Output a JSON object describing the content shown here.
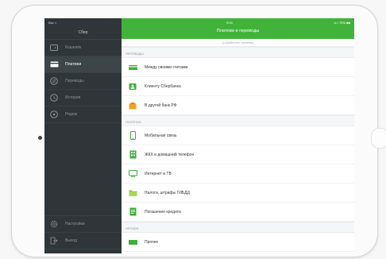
{
  "sidebar": {
    "status": {
      "carrier": "Вас ≈",
      "time": ""
    },
    "title": "Сбер",
    "items": [
      {
        "label": "Кошелёк",
        "icon": "wallet-icon",
        "active": false
      },
      {
        "label": "Платежи",
        "icon": "payments-icon",
        "active": true
      },
      {
        "label": "Переводы",
        "icon": "transfer-icon",
        "active": false
      },
      {
        "label": "История",
        "icon": "history-icon",
        "active": false
      },
      {
        "label": "Рядом",
        "icon": "location-icon",
        "active": false
      }
    ],
    "bottom_items": [
      {
        "label": "Настройки",
        "icon": "gear-icon"
      },
      {
        "label": "Выход",
        "icon": "exit-icon"
      }
    ]
  },
  "main": {
    "status": {
      "time": "9:41",
      "battery": "◂ ⌂ 76% ■■"
    },
    "title": "Платежи и переводы",
    "search_placeholder": "Q  Шаблоны, платежи",
    "sections": [
      {
        "title": "Переводы",
        "rows": [
          {
            "label": "Между своими счетами",
            "icon": "cards-icon",
            "color": "#3fae3a"
          },
          {
            "label": "Клиенту Сбербанка",
            "icon": "person-icon",
            "color": "#3fae3a"
          },
          {
            "label": "В другой банк РФ",
            "icon": "bank-icon",
            "color": "#f2a41c"
          }
        ]
      },
      {
        "title": "Платежи",
        "rows": [
          {
            "label": "Мобильная связь",
            "icon": "phone-icon",
            "color": "#3fae3a"
          },
          {
            "label": "ЖКХ и домашний телефон",
            "icon": "house-icon",
            "color": "#3fae3a"
          },
          {
            "label": "Интернет и ТВ",
            "icon": "tv-icon",
            "color": "#3fae3a"
          },
          {
            "label": "Налоги, штрафы ГИБДД",
            "icon": "folder-icon",
            "color": "#8fc83d"
          },
          {
            "label": "Погашение кредита",
            "icon": "document-icon",
            "color": "#3fae3a"
          }
        ]
      },
      {
        "title": "Прочее",
        "rows": [
          {
            "label": "Прочее",
            "icon": "more-icon",
            "color": "#3fae3a"
          }
        ]
      }
    ]
  },
  "colors": {
    "accent": "#42b33a",
    "sidebar_bg": "#2f3538"
  }
}
